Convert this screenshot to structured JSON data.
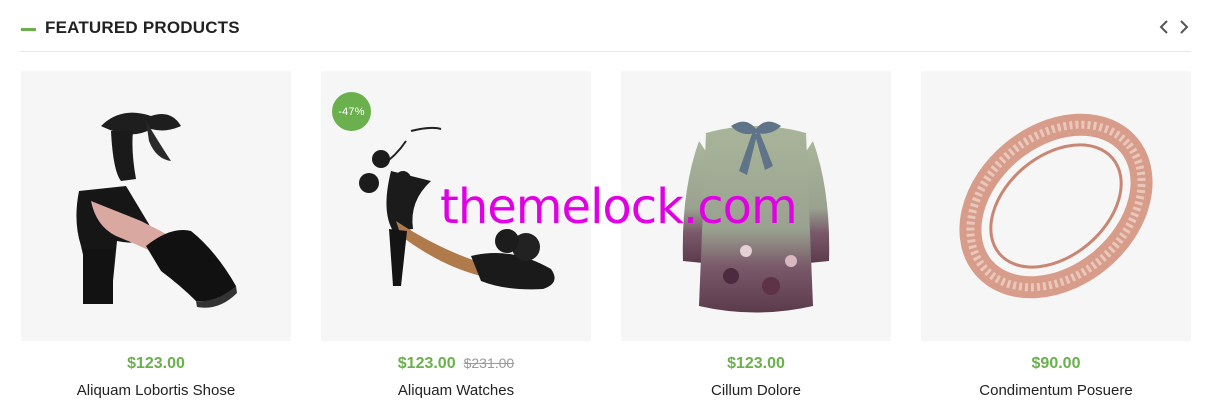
{
  "section": {
    "title": "FEATURED PRODUCTS",
    "accent_color": "#6ab04c",
    "prev_icon": "chevron-left-icon",
    "next_icon": "chevron-right-icon"
  },
  "products": [
    {
      "price": "$123.00",
      "old_price": "",
      "badge": "",
      "name": "Aliquam Lobortis Shose",
      "image": "black-satin-block-heel-sandal"
    },
    {
      "price": "$123.00",
      "old_price": "$231.00",
      "badge": "-47%",
      "name": "Aliquam Watches",
      "image": "black-pom-pom-heel-sandal"
    },
    {
      "price": "$123.00",
      "old_price": "",
      "badge": "",
      "name": "Cillum Dolore",
      "image": "floral-blouse-with-bow"
    },
    {
      "price": "$90.00",
      "old_price": "",
      "badge": "",
      "name": "Condimentum Posuere",
      "image": "rose-gold-diamond-ring"
    }
  ],
  "watermark": "themelock.com"
}
